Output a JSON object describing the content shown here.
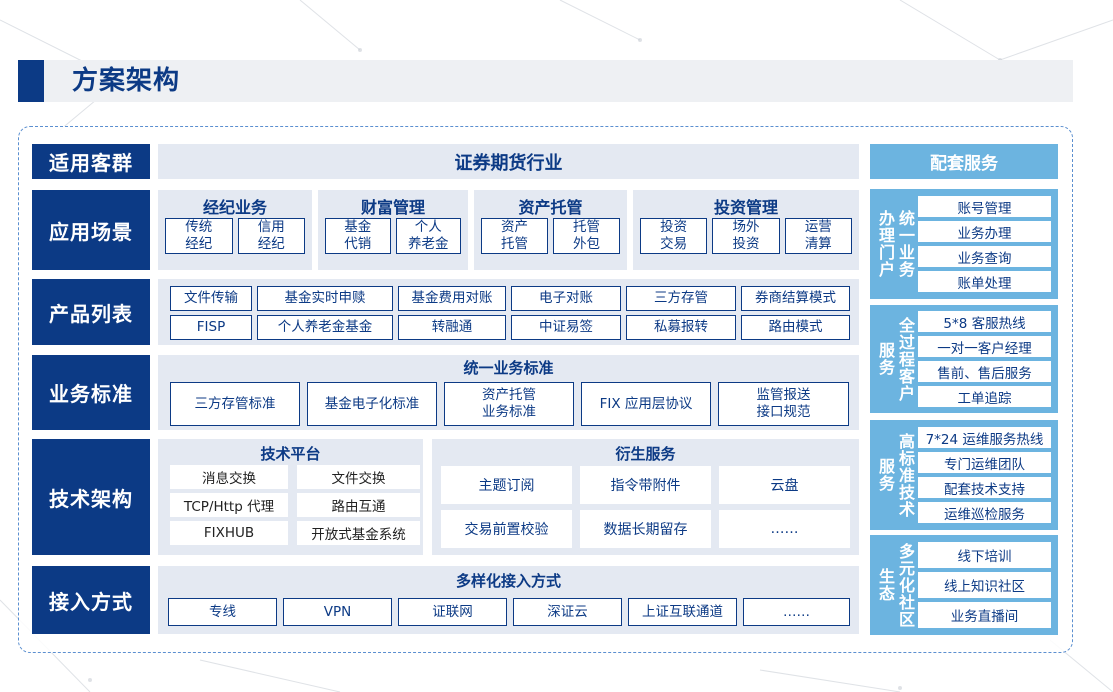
{
  "title": "方案架构",
  "categories": [
    "适用客群",
    "应用场景",
    "产品列表",
    "业务标准",
    "技术架构",
    "接入方式"
  ],
  "customer_group": "证券期货行业",
  "scenarios": [
    {
      "title": "经纪业务",
      "items": [
        "传统\n经纪",
        "信用\n经纪"
      ]
    },
    {
      "title": "财富管理",
      "items": [
        "基金\n代销",
        "个人\n养老金"
      ]
    },
    {
      "title": "资产托管",
      "items": [
        "资产\n托管",
        "托管\n外包"
      ]
    },
    {
      "title": "投资管理",
      "items": [
        "投资\n交易",
        "场外\n投资",
        "运营\n清算"
      ]
    }
  ],
  "products": [
    [
      "文件传输",
      "基金实时申赎",
      "基金费用对账",
      "电子对账",
      "三方存管",
      "券商结算模式"
    ],
    [
      "FISP",
      "个人养老金基金",
      "转融通",
      "中证易签",
      "私募报转",
      "路由模式"
    ]
  ],
  "standards": {
    "title": "统一业务标准",
    "items": [
      "三方存管标准",
      "基金电子化标准",
      "资产托管\n业务标准",
      "FIX 应用层协议",
      "监管报送\n接口规范"
    ]
  },
  "tech": {
    "platform_title": "技术平台",
    "platform_items": [
      [
        "消息交换",
        "文件交换"
      ],
      [
        "TCP/Http 代理",
        "路由互通"
      ],
      [
        "FIXHUB",
        "开放式基金系统"
      ]
    ],
    "derived_title": "衍生服务",
    "derived_items": [
      [
        "主题订阅",
        "指令带附件",
        "云盘"
      ],
      [
        "交易前置校验",
        "数据长期留存",
        "……"
      ]
    ]
  },
  "access": {
    "title": "多样化接入方式",
    "items": [
      "专线",
      "VPN",
      "证联网",
      "深证云",
      "上证互联通道",
      "……"
    ]
  },
  "services": {
    "title": "配套服务",
    "groups": [
      {
        "label_a": "办\n理\n门\n户",
        "label_b": "统\n一\n业\n务",
        "items": [
          "账号管理",
          "业务办理",
          "业务查询",
          "账单处理"
        ]
      },
      {
        "label_a": "服\n务",
        "label_b": "全\n过\n程\n客\n户",
        "items": [
          "5*8 客服热线",
          "一对一客户经理",
          "售前、售后服务",
          "工单追踪"
        ]
      },
      {
        "label_a": "服\n务",
        "label_b": "高\n标\n准\n技\n术",
        "items": [
          "7*24 运维服务热线",
          "专门运维团队",
          "配套技术支持",
          "运维巡检服务"
        ]
      },
      {
        "label_a": "生\n态",
        "label_b": "多\n元\n化\n社\n区",
        "items": [
          "线下培训",
          "线上知识社区",
          "业务直播间"
        ]
      }
    ]
  },
  "colors": {
    "primary": "#0c3a85",
    "accent": "#6cb4e0",
    "panel": "#e4e9f2"
  }
}
